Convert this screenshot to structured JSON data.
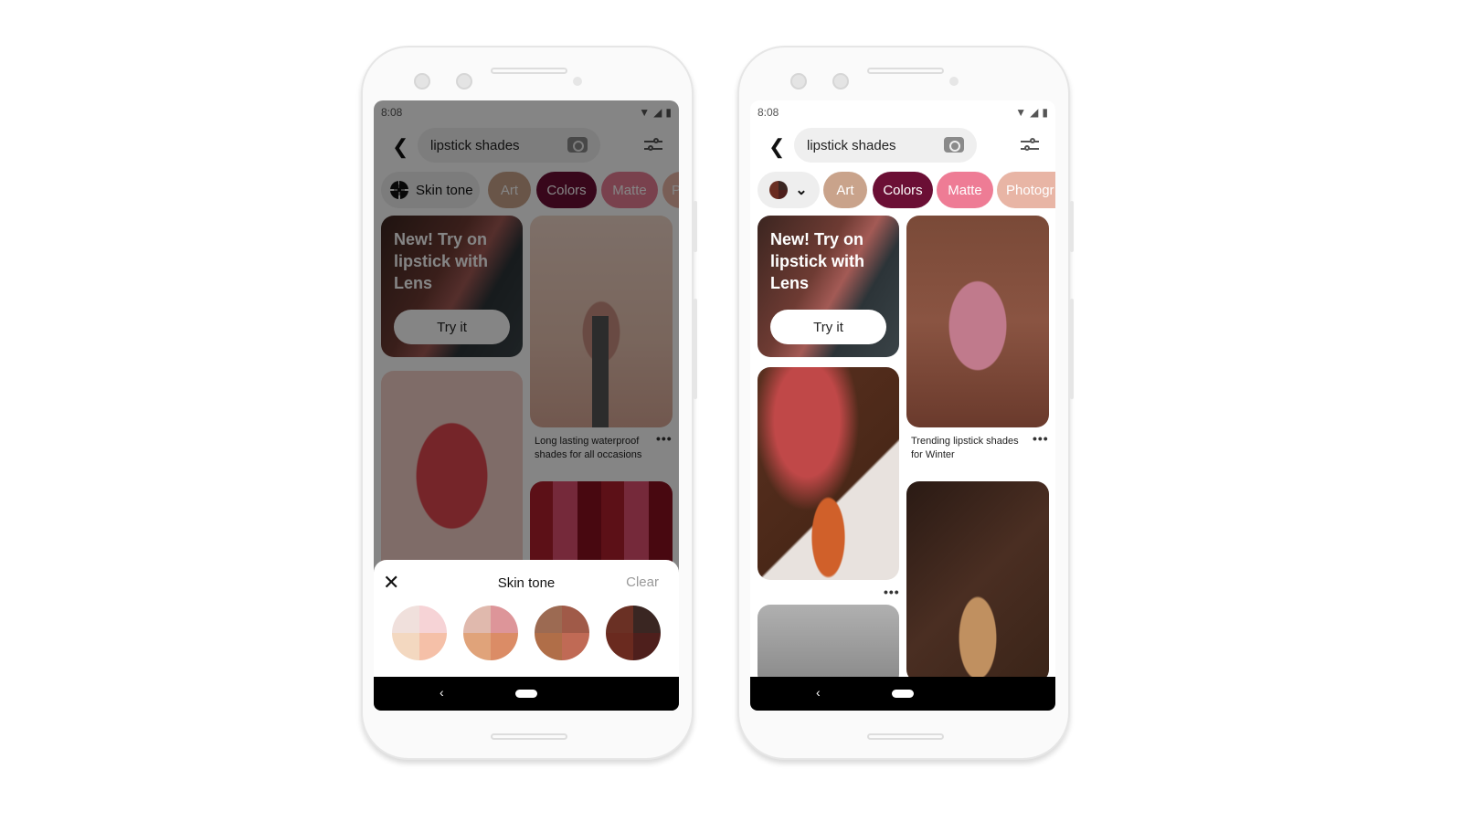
{
  "phones": [
    {
      "status_time": "8:08",
      "search_value": "lipstick shades",
      "chips": [
        {
          "label": "Skin tone",
          "color": "#eeeeee"
        },
        {
          "label": "Art",
          "color": "#c9a38b"
        },
        {
          "label": "Colors",
          "color": "#6b0f35"
        },
        {
          "label": "Matte",
          "color": "#e97d95"
        },
        {
          "label": "P",
          "color": "#e8b5a5"
        }
      ],
      "lens_card": {
        "title": "New! Try on lipstick with Lens",
        "button": "Try it"
      },
      "pin_caption": "Long lasting waterproof shades for all occasions",
      "sheet": {
        "close": "✕",
        "title": "Skin tone",
        "clear": "Clear",
        "swatches": [
          [
            "#f0e0dc",
            "#f6d3d6",
            "#f3d8c0",
            "#f5c0a8"
          ],
          [
            "#e0b9ad",
            "#dd9599",
            "#e0a37a",
            "#db8c66"
          ],
          [
            "#9c6a52",
            "#a05a48",
            "#b06e48",
            "#c06a55"
          ],
          [
            "#6a3024",
            "#3a2622",
            "#6a2a1f",
            "#4e1f1c"
          ]
        ]
      }
    },
    {
      "status_time": "8:08",
      "search_value": "lipstick shades",
      "chips": [
        {
          "label": "",
          "color": "#eeeeee"
        },
        {
          "label": "Art",
          "color": "#c9a38b"
        },
        {
          "label": "Colors",
          "color": "#6b0f35"
        },
        {
          "label": "Matte",
          "color": "#ee7c95"
        },
        {
          "label": "Photogr",
          "color": "#e8b5a5"
        }
      ],
      "lens_card": {
        "title": "New! Try on lipstick with Lens",
        "button": "Try it"
      },
      "pin_caption": "Trending lipstick shades for Winter"
    }
  ],
  "icons": {
    "more": "•••",
    "back": "‹"
  }
}
